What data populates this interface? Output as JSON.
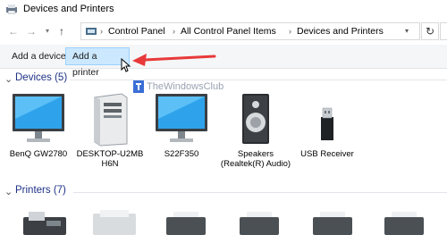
{
  "window": {
    "title": "Devices and Printers"
  },
  "address": {
    "breadcrumbs": [
      "Control Panel",
      "All Control Panel Items",
      "Devices and Printers"
    ]
  },
  "commands": {
    "add_device": "Add a device",
    "add_printer": "Add a printer"
  },
  "groups": {
    "devices": {
      "title": "Devices (5)",
      "items": [
        {
          "label": "BenQ GW2780",
          "icon": "monitor-icon"
        },
        {
          "label": "DESKTOP-U2MB H6N",
          "icon": "computer-tower-icon"
        },
        {
          "label": "S22F350",
          "icon": "monitor-icon"
        },
        {
          "label": "Speakers (Realtek(R) Audio)",
          "icon": "speaker-icon"
        },
        {
          "label": "USB Receiver",
          "icon": "usb-receiver-icon"
        }
      ]
    },
    "printers": {
      "title": "Printers (7)"
    }
  },
  "watermark": {
    "text": "TheWindowsClub"
  },
  "colors": {
    "accent": "#0078d7",
    "group_title": "#1e3287",
    "hover_fill": "#cce8ff",
    "hover_border": "#99d1ff",
    "annotation_arrow": "#e8393a"
  }
}
